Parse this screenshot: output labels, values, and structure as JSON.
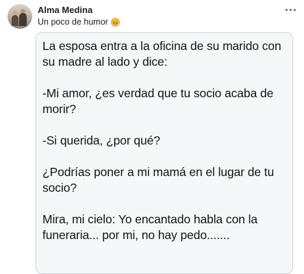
{
  "post": {
    "author": "Alma Medina",
    "group": "Un poco de humor",
    "group_emoji": "grinning-face-emoji",
    "more_icon": "more-options-icon"
  },
  "content": {
    "paragraphs": [
      "La esposa entra a la oficina de su marido con su madre al lado y dice:",
      "-Mi amor, ¿es verdad que tu socio acaba de morir?",
      "-Si querida, ¿por qué?",
      "¿Podrías poner a mi mamá en el lugar de tu socio?",
      "Mira, mi cielo: Yo encantado habla con la funeraria... por mi, no hay pedo......."
    ]
  },
  "colors": {
    "card_background": "#f6f7f8",
    "card_border": "#d0d3d6",
    "text": "#141414",
    "emoji": "#f7c443"
  }
}
